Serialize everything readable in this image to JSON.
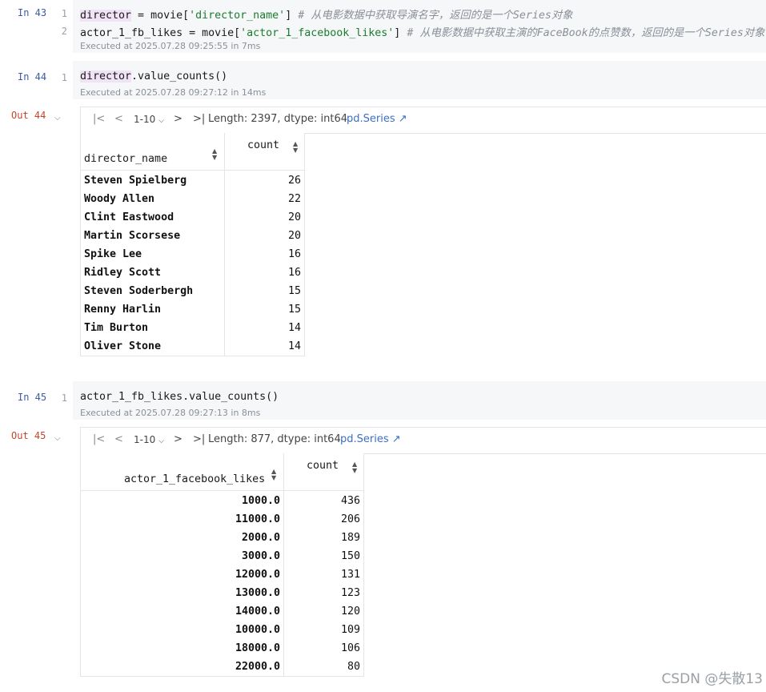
{
  "cells": [
    {
      "label": "In 43",
      "lines": [
        {
          "no": "1",
          "var": "director",
          "mid": " = movie[",
          "str": "'director_name'",
          "end": "] ",
          "comment": "# 从电影数据中获取导演名字，返回的是一个Series对象"
        },
        {
          "no": "2",
          "var": "actor_1_fb_likes",
          "mid": " = movie[",
          "str": "'actor_1_facebook_likes'",
          "end": "] ",
          "comment": "# 从电影数据中获取主演的FaceBook的点赞数，返回的是一个Series对象"
        }
      ],
      "exec": "Executed at 2025.07.28 09:25:55 in 7ms"
    },
    {
      "label": "In 44",
      "line_no": "1",
      "code_var": "director",
      "code_rest": ".value_counts()",
      "exec": "Executed at 2025.07.28 09:27:12 in 14ms",
      "out_label": "Out 44",
      "toolbar": {
        "range": "1-10",
        "info": "Length: 2397, dtype: int64",
        "link": "pd.Series ↗"
      },
      "columns": [
        "director_name",
        "count"
      ],
      "rows": [
        [
          "Steven Spielberg",
          "26"
        ],
        [
          "Woody Allen",
          "22"
        ],
        [
          "Clint Eastwood",
          "20"
        ],
        [
          "Martin Scorsese",
          "20"
        ],
        [
          "Spike Lee",
          "16"
        ],
        [
          "Ridley Scott",
          "16"
        ],
        [
          "Steven Soderbergh",
          "15"
        ],
        [
          "Renny Harlin",
          "15"
        ],
        [
          "Tim Burton",
          "14"
        ],
        [
          "Oliver Stone",
          "14"
        ]
      ]
    },
    {
      "label": "In 45",
      "line_no": "1",
      "code": "actor_1_fb_likes.value_counts()",
      "exec": "Executed at 2025.07.28 09:27:13 in 8ms",
      "out_label": "Out 45",
      "toolbar": {
        "range": "1-10",
        "info": "Length: 877, dtype: int64",
        "link": "pd.Series ↗"
      },
      "columns": [
        "actor_1_facebook_likes",
        "count"
      ],
      "rows": [
        [
          "1000.0",
          "436"
        ],
        [
          "11000.0",
          "206"
        ],
        [
          "2000.0",
          "189"
        ],
        [
          "3000.0",
          "150"
        ],
        [
          "12000.0",
          "131"
        ],
        [
          "13000.0",
          "123"
        ],
        [
          "14000.0",
          "120"
        ],
        [
          "10000.0",
          "109"
        ],
        [
          "18000.0",
          "106"
        ],
        [
          "22000.0",
          "80"
        ]
      ]
    }
  ],
  "watermark": "CSDN @失散13"
}
